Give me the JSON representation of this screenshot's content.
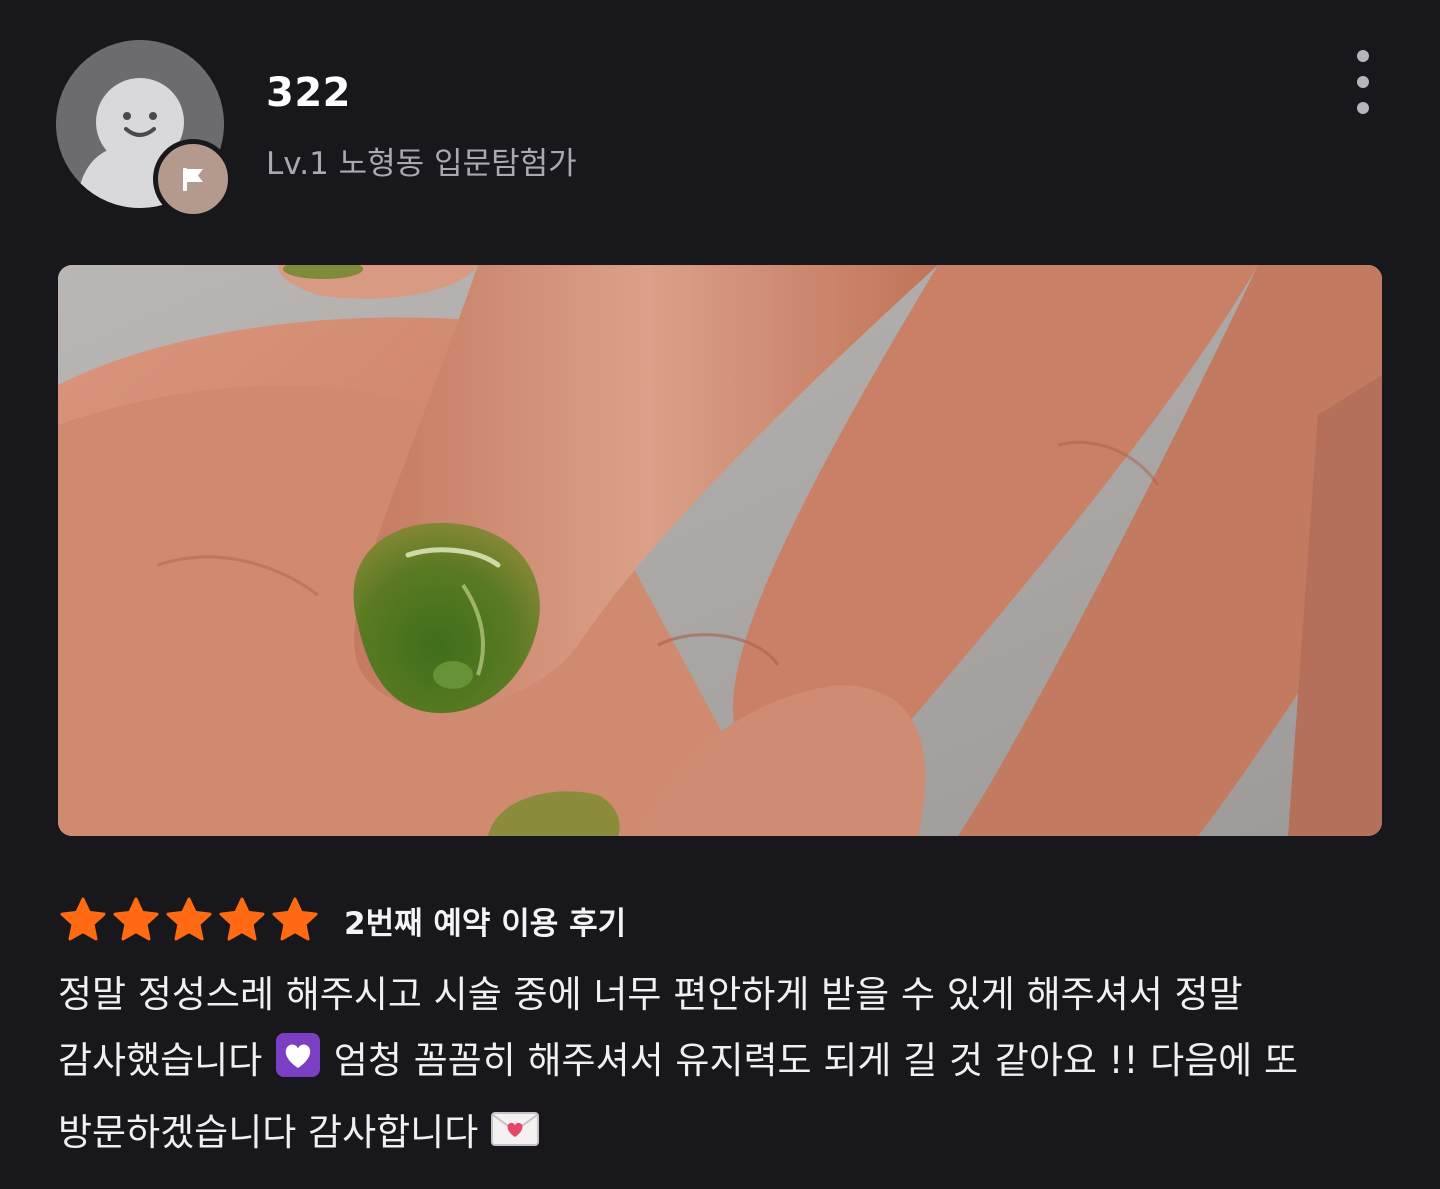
{
  "user": {
    "name": "322",
    "level": "Lv.1 노형동 입문탐험가",
    "avatar_icon": "smiley-person-icon",
    "badge_icon": "flag-icon"
  },
  "menu": {
    "icon": "more-vertical-icon"
  },
  "photo": {
    "subject": "hand-with-green-nail-photo"
  },
  "review": {
    "rating": 5,
    "rating_max": 5,
    "title": "2번째 예약 이용 후기",
    "text_part1": "정말 정성스레 해주시고 시술 중에 너무 편안하게 받을 수 있게 해주셔서 정말 감사했습니다 ",
    "text_part2": " 엄청 꼼꼼히 해주셔서 유지력도 되게 길 것 같아요 !! 다음에 또 방문하겠습니다 감사합니다 ",
    "emoji1": "heart-emoji",
    "emoji2": "love-letter-emoji"
  },
  "colors": {
    "background": "#18181c",
    "star": "#ff6a13",
    "badge": "#b39a8c",
    "heart_box": "#7b3fc4"
  }
}
